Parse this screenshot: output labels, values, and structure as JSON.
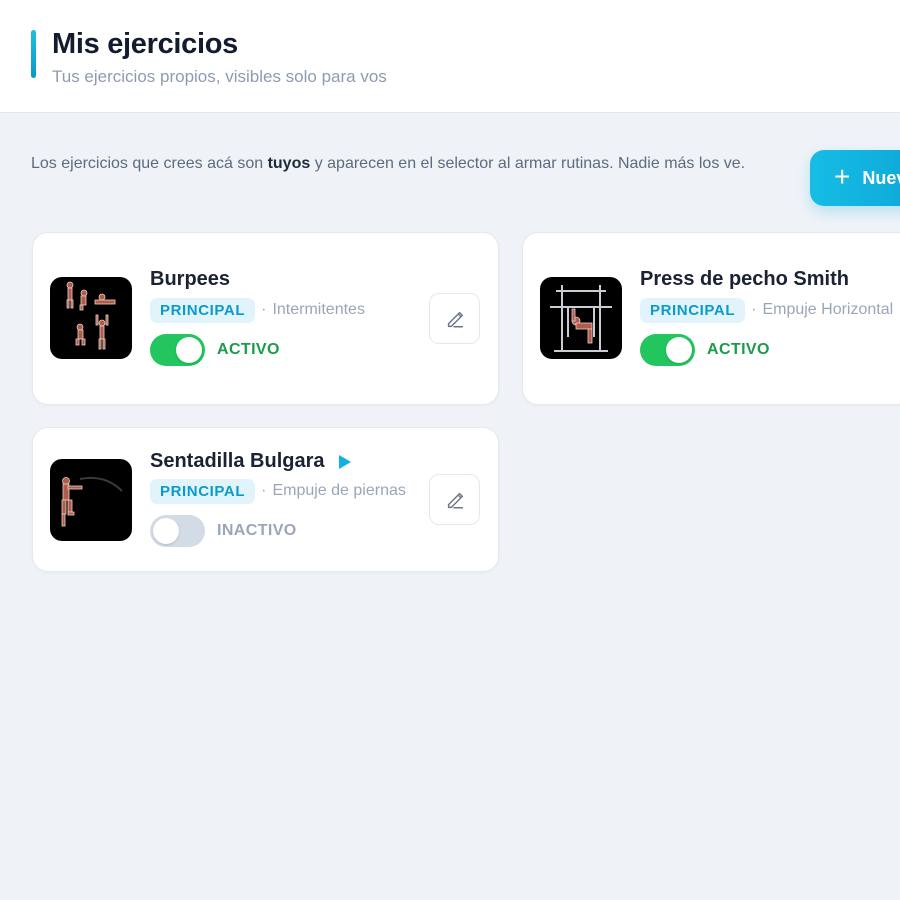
{
  "header": {
    "title": "Mis ejercicios",
    "subtitle": "Tus ejercicios propios, visibles solo para vos"
  },
  "intro": {
    "part1": "Los ejercicios que crees acá son ",
    "bold": "tuyos",
    "part2": " y aparecen en el selector al armar rutinas. Nadie más los ve."
  },
  "new_button": {
    "icon": "+",
    "label": "Nuevo"
  },
  "exercises": [
    {
      "name": "Burpees",
      "badge": "PRINCIPAL",
      "separator": "·",
      "muscle": "Intermitentes",
      "status": "ACTIVO",
      "active": true,
      "has_video": false,
      "thumbnail": "burpees-thumbnail"
    },
    {
      "name": "Press de pecho Smith",
      "badge": "PRINCIPAL",
      "separator": "·",
      "muscle": "Empuje Horizontal",
      "status": "ACTIVO",
      "active": true,
      "has_video": false,
      "thumbnail": "smith-press-thumbnail"
    },
    {
      "name": "Sentadilla Bulgara",
      "badge": "PRINCIPAL",
      "separator": "·",
      "muscle": "Empuje de piernas",
      "status": "INACTIVO",
      "active": false,
      "has_video": true,
      "thumbnail": "bulgarian-squat-thumbnail"
    }
  ],
  "colors": {
    "accent": "#12b2de",
    "active_green": "#22c55e",
    "background": "#eff3f8"
  }
}
